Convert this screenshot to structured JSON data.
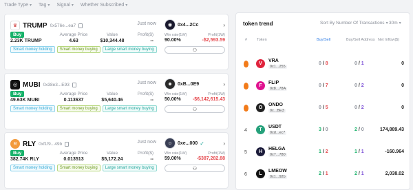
{
  "filters": [
    "Trade Type",
    "Tag",
    "Signal",
    "Whether Subscribed"
  ],
  "cards": [
    {
      "token": "TRUMP",
      "addr": "0x576e...ea7",
      "time": "Just now",
      "icon_color": "#ffffff",
      "icon_text": "T",
      "headers": [
        "",
        "Average Price",
        "Value",
        "Profit($)"
      ],
      "badge": "Buy",
      "amount": "2.23K TRUMP",
      "avg": "4.63",
      "value": "$10,344.48",
      "profit": "--",
      "tags": [
        "Smart money holding",
        "Smart money buying",
        "Large smart money buying"
      ],
      "wallet": "0x4...2Cc",
      "wr_label": "Win rate(1W)",
      "pf_label": "Profit(1W)",
      "winrate": "90.00%",
      "wprofit": "-$2,593.59"
    },
    {
      "token": "MUBI",
      "addr": "0x38e3...E93",
      "time": "Just now",
      "icon_color": "#111111",
      "icon_text": "M",
      "headers": [
        "",
        "Average Price",
        "Value",
        "Profit($)"
      ],
      "badge": "Buy",
      "amount": "49.63K MUBI",
      "avg": "0.113637",
      "value": "$5,640.46",
      "profit": "--",
      "tags": [
        "Smart money holding",
        "Smart money buying",
        "Large smart money buying"
      ],
      "wallet": "0xB...0E9",
      "wr_label": "Win rate(1W)",
      "pf_label": "Profit(1W)",
      "winrate": "50.00%",
      "wprofit": "-$6,142,615.43"
    },
    {
      "token": "RLY",
      "addr": "0xf1f9...49b",
      "time": "Just now",
      "icon_color": "#f39a3c",
      "icon_text": "R",
      "headers": [
        "",
        "Average Price",
        "Value",
        "Profit($)"
      ],
      "badge": "Buy",
      "amount": "382.74K RLY",
      "avg": "0.013513",
      "value": "$5,172.24",
      "profit": "--",
      "tags": [
        "Smart money holding",
        "Smart money buying",
        "Large smart money buying"
      ],
      "wallet": "0xe...000",
      "wr_label": "Win rate(1W)",
      "pf_label": "Profit(1W)",
      "winrate": "59.00%",
      "wprofit": "-$387,282.88"
    }
  ],
  "panel": {
    "title": "token trend",
    "sort": "Sort By Number Of Transactions",
    "interval": "30m",
    "headers": {
      "rank": "#",
      "token": "Token",
      "bs": "Buy/Sell",
      "bsa": "Buy/Sell Address",
      "inflow": "Net Inflow($)"
    },
    "rows": [
      {
        "rank": "1",
        "hot": true,
        "name": "VRA",
        "addr": "0x1...255",
        "icon_color": "#e0233c",
        "icon_text": "V",
        "buy": "0",
        "sell": "8",
        "buy_addr": "0",
        "sell_addr": "1",
        "inflow": "0"
      },
      {
        "rank": "2",
        "hot": true,
        "name": "FLIP",
        "addr": "0x8...78A",
        "icon_color": "#e0128f",
        "icon_text": "F",
        "buy": "0",
        "sell": "7",
        "buy_addr": "0",
        "sell_addr": "2",
        "inflow": "0"
      },
      {
        "rank": "3",
        "hot": true,
        "name": "ONDO",
        "addr": "0x...BE3",
        "icon_color": "#222222",
        "icon_text": "O",
        "buy": "0",
        "sell": "5",
        "buy_addr": "0",
        "sell_addr": "2",
        "inflow": "0"
      },
      {
        "rank": "4",
        "hot": false,
        "name": "USDT",
        "addr": "0xd...ec7",
        "icon_color": "#26a17b",
        "icon_text": "T",
        "buy": "3",
        "sell": "0",
        "buy_addr": "2",
        "sell_addr": "0",
        "inflow": "174,889.43"
      },
      {
        "rank": "5",
        "hot": false,
        "name": "HELGA",
        "addr": "0x7...780",
        "icon_color": "#1b1b3a",
        "icon_text": "H",
        "buy": "1",
        "sell": "2",
        "buy_addr": "1",
        "sell_addr": "1",
        "inflow": "-160.964"
      },
      {
        "rank": "6",
        "hot": false,
        "name": "LMEOW",
        "addr": "0x1...92b",
        "icon_color": "#111111",
        "icon_text": "L",
        "buy": "2",
        "sell": "1",
        "buy_addr": "2",
        "sell_addr": "1",
        "inflow": "2,038.02"
      }
    ]
  }
}
